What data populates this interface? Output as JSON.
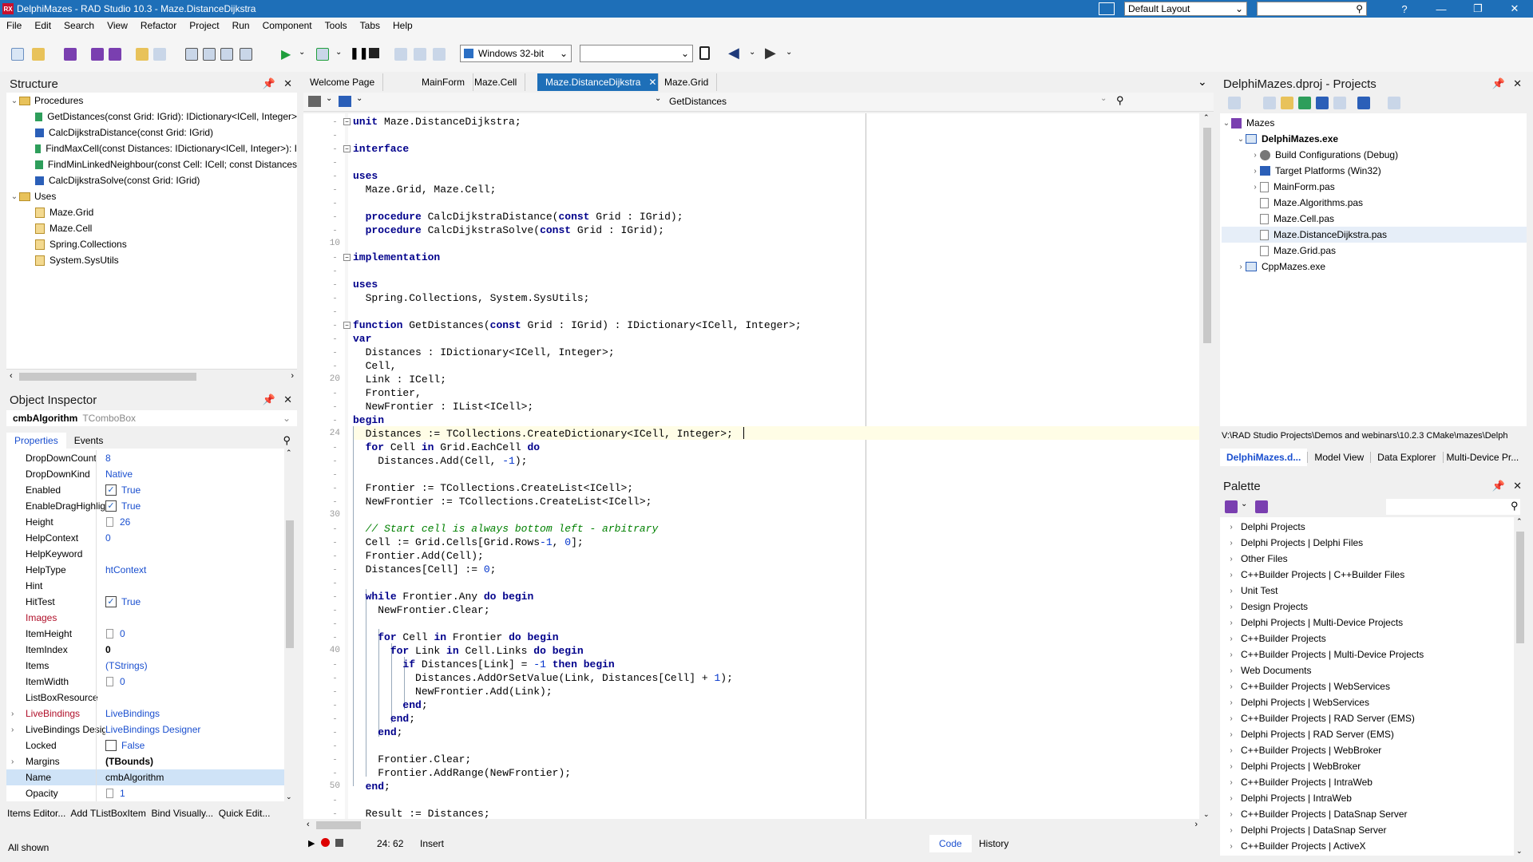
{
  "window": {
    "app_badge": "RX",
    "title": "DelphiMazes - RAD Studio 10.3 - Maze.DistanceDijkstra",
    "layout_combo": "Default Layout",
    "help": "?"
  },
  "menu": [
    "File",
    "Edit",
    "Search",
    "View",
    "Refactor",
    "Project",
    "Run",
    "Component",
    "Tools",
    "Tabs",
    "Help"
  ],
  "toolbar": {
    "platform": "Windows 32-bit",
    "config": ""
  },
  "structure": {
    "title": "Structure",
    "procedures_label": "Procedures",
    "procedures": [
      {
        "label": "GetDistances(const Grid: IGrid): IDictionary<ICell, Integer>",
        "color": "#2e9e5b"
      },
      {
        "label": "CalcDijkstraDistance(const Grid: IGrid)",
        "color": "#2b5fb8"
      },
      {
        "label": "FindMaxCell(const Distances: IDictionary<ICell, Integer>): I",
        "color": "#2e9e5b"
      },
      {
        "label": "FindMinLinkedNeighbour(const Cell: ICell; const Distances",
        "color": "#2e9e5b"
      },
      {
        "label": "CalcDijkstraSolve(const Grid: IGrid)",
        "color": "#2b5fb8"
      }
    ],
    "uses_label": "Uses",
    "uses": [
      "Maze.Grid",
      "Maze.Cell",
      "Spring.Collections",
      "System.SysUtils"
    ]
  },
  "inspector": {
    "title": "Object Inspector",
    "component": "cmbAlgorithm",
    "component_type": "TComboBox",
    "tab_properties": "Properties",
    "tab_events": "Events",
    "rows": [
      {
        "name": "DropDownCount",
        "value": "8"
      },
      {
        "name": "DropDownKind",
        "value": "Native"
      },
      {
        "name": "Enabled",
        "value": "True",
        "check": "on"
      },
      {
        "name": "EnableDragHighlight",
        "value": "True",
        "check": "on"
      },
      {
        "name": "Height",
        "value": "26",
        "icon": true
      },
      {
        "name": "HelpContext",
        "value": "0"
      },
      {
        "name": "HelpKeyword",
        "value": ""
      },
      {
        "name": "HelpType",
        "value": "htContext"
      },
      {
        "name": "Hint",
        "value": ""
      },
      {
        "name": "HitTest",
        "value": "True",
        "check": "on"
      },
      {
        "name": "Images",
        "value": "",
        "red": true
      },
      {
        "name": "ItemHeight",
        "value": "0",
        "icon": true
      },
      {
        "name": "ItemIndex",
        "value": "0",
        "bold": true
      },
      {
        "name": "Items",
        "value": "(TStrings)"
      },
      {
        "name": "ItemWidth",
        "value": "0",
        "icon": true
      },
      {
        "name": "ListBoxResource",
        "value": ""
      },
      {
        "name": "LiveBindings",
        "value": "LiveBindings",
        "red": true,
        "expand": true
      },
      {
        "name": "LiveBindings Designer",
        "value": "LiveBindings Designer",
        "expand": true
      },
      {
        "name": "Locked",
        "value": "False",
        "check": "off"
      },
      {
        "name": "Margins",
        "value": "(TBounds)",
        "bold": true,
        "expand": true
      },
      {
        "name": "Name",
        "value": "cmbAlgorithm",
        "selected": true
      },
      {
        "name": "Opacity",
        "value": "1",
        "icon": true
      }
    ],
    "actions": "Items Editor...  Add TListBoxItem  Bind Visually...  Quick Edit...",
    "status": "All shown"
  },
  "editor": {
    "tabs": [
      "Welcome Page",
      "MainForm",
      "Maze.Cell",
      "Maze.DistanceDijkstra",
      "Maze.Grid"
    ],
    "active_tab": "Maze.DistanceDijkstra",
    "method_combo": "GetDistances",
    "line_numbers": [
      {
        "n": "10",
        "row": 9
      },
      {
        "n": "20",
        "row": 19
      },
      {
        "n": "24",
        "row": 23
      },
      {
        "n": "30",
        "row": 29
      },
      {
        "n": "40",
        "row": 39
      },
      {
        "n": "50",
        "row": 49
      }
    ],
    "code": [
      "unit Maze.DistanceDijkstra;",
      "",
      "interface",
      "",
      "uses",
      "  Maze.Grid, Maze.Cell;",
      "",
      "  procedure CalcDijkstraDistance(const Grid : IGrid);",
      "  procedure CalcDijkstraSolve(const Grid : IGrid);",
      "",
      "implementation",
      "",
      "uses",
      "  Spring.Collections, System.SysUtils;",
      "",
      "function GetDistances(const Grid : IGrid) : IDictionary<ICell, Integer>;",
      "var",
      "  Distances : IDictionary<ICell, Integer>;",
      "  Cell,",
      "  Link : ICell;",
      "  Frontier,",
      "  NewFrontier : IList<ICell>;",
      "begin",
      "  Distances := TCollections.CreateDictionary<ICell, Integer>;",
      "  for Cell in Grid.EachCell do",
      "    Distances.Add(Cell, -1);",
      "",
      "  Frontier := TCollections.CreateList<ICell>;",
      "  NewFrontier := TCollections.CreateList<ICell>;",
      "",
      "  // Start cell is always bottom left - arbitrary",
      "  Cell := Grid.Cells[Grid.Rows-1, 0];",
      "  Frontier.Add(Cell);",
      "  Distances[Cell] := 0;",
      "",
      "  while Frontier.Any do begin",
      "    NewFrontier.Clear;",
      "",
      "    for Cell in Frontier do begin",
      "      for Link in Cell.Links do begin",
      "        if Distances[Link] = -1 then begin",
      "          Distances.AddOrSetValue(Link, Distances[Cell] + 1);",
      "          NewFrontier.Add(Link);",
      "        end;",
      "      end;",
      "    end;",
      "",
      "    Frontier.Clear;",
      "    Frontier.AddRange(NewFrontier);",
      "  end;",
      "",
      "  Result := Distances;"
    ],
    "cursor_pos": "24: 62",
    "mode": "Insert",
    "bottom_tab_code": "Code",
    "bottom_tab_history": "History"
  },
  "projects": {
    "title": "DelphiMazes.dproj - Projects",
    "items": [
      {
        "label": "Mazes",
        "level": 0
      },
      {
        "label": "DelphiMazes.exe",
        "level": 1,
        "bold": true
      },
      {
        "label": "Build Configurations (Debug)",
        "level": 2
      },
      {
        "label": "Target Platforms (Win32)",
        "level": 2
      },
      {
        "label": "MainForm.pas",
        "level": 2
      },
      {
        "label": "Maze.Algorithms.pas",
        "level": 2
      },
      {
        "label": "Maze.Cell.pas",
        "level": 2
      },
      {
        "label": "Maze.DistanceDijkstra.pas",
        "level": 2,
        "selected": true
      },
      {
        "label": "Maze.Grid.pas",
        "level": 2
      },
      {
        "label": "CppMazes.exe",
        "level": 1
      }
    ],
    "path": "V:\\RAD Studio Projects\\Demos and webinars\\10.2.3 CMake\\mazes\\Delph",
    "bottom_tabs": [
      "DelphiMazes.d...",
      "Model View",
      "Data Explorer",
      "Multi-Device Pr..."
    ]
  },
  "palette": {
    "title": "Palette",
    "items": [
      "Delphi Projects",
      "Delphi Projects | Delphi Files",
      "Other Files",
      "C++Builder Projects | C++Builder Files",
      "Unit Test",
      "Design Projects",
      "Delphi Projects | Multi-Device Projects",
      "C++Builder Projects",
      "C++Builder Projects | Multi-Device Projects",
      "Web Documents",
      "C++Builder Projects | WebServices",
      "Delphi Projects | WebServices",
      "C++Builder Projects | RAD Server (EMS)",
      "Delphi Projects | RAD Server (EMS)",
      "C++Builder Projects | WebBroker",
      "Delphi Projects | WebBroker",
      "C++Builder Projects | IntraWeb",
      "Delphi Projects | IntraWeb",
      "C++Builder Projects | DataSnap Server",
      "Delphi Projects | DataSnap Server",
      "C++Builder Projects | ActiveX"
    ]
  }
}
